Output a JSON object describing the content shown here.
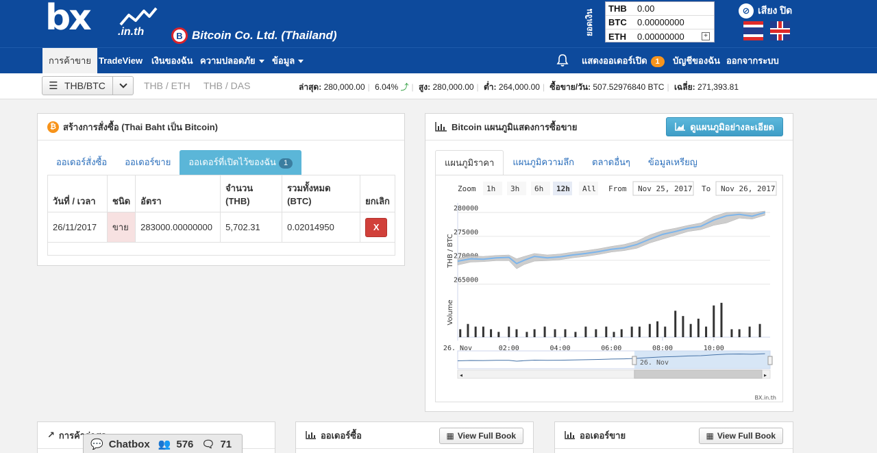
{
  "header": {
    "logo_main": "bx",
    "logo_sub": ".in.th",
    "company_name": "Bitcoin Co. Ltd. (Thailand)",
    "company_icon_letter": "B",
    "balance_label": "ยอดเงิน",
    "balances": [
      {
        "currency": "THB",
        "amount": "0.00"
      },
      {
        "currency": "BTC",
        "amount": "0.00000000"
      },
      {
        "currency": "ETH",
        "amount": "0.00000000"
      }
    ],
    "expand_symbol": "+",
    "sound_label": "เสียง ปิด"
  },
  "nav": {
    "items": [
      "การค้าขาย",
      "TradeView",
      "เงินของฉัน",
      "ความปลอดภัย",
      "ข้อมูล"
    ],
    "open_orders_label": "แสดงออเดอร์เปิด",
    "open_orders_count": "1",
    "account_label": "บัญชีของฉัน",
    "logout_label": "ออกจากระบบ"
  },
  "ticker": {
    "selected_pair": "THB/BTC",
    "pairs": [
      "THB / ETH",
      "THB / DAS"
    ],
    "last_label": "ล่าสุด:",
    "last_value": "280,000.00",
    "change": "6.04%",
    "high_label": "สูง:",
    "high_value": "280,000.00",
    "low_label": "ต่ำ:",
    "low_value": "264,000.00",
    "volume_label": "ซื้อขาย/วัน:",
    "volume_value": "507.52976840 BTC",
    "avg_label": "เฉลี่ย:",
    "avg_value": "271,393.81"
  },
  "order_panel": {
    "title": "สร้างการสั่งซื้อ (Thai Baht เป็น Bitcoin)",
    "tabs": [
      "ออเดอร์สั่งซื้อ",
      "ออเดอร์ขาย",
      "ออเดอร์ที่เปิดไว้ของฉัน"
    ],
    "tab_badge": "1",
    "columns": [
      "วันที่ / เวลา",
      "ชนิด",
      "อัตรา",
      "จำนวน (THB)",
      "รวมทั้งหมด (BTC)",
      "ยกเลิก"
    ],
    "rows": [
      {
        "date": "26/11/2017",
        "type": "ขาย",
        "rate": "283000.00000000",
        "amount": "5,702.31",
        "total": "0.02014950",
        "cancel": "X"
      }
    ]
  },
  "chart_panel": {
    "title": "Bitcoin แผนภูมิแสดงการซื้อขาย",
    "detail_button": "ดูแผนภูมิอย่างละเอียด",
    "tabs": [
      "แผนภูมิราคา",
      "แผนภูมิความลึก",
      "ตลาดอื่นๆ",
      "ข้อมูลเหรียญ"
    ],
    "zoom_label": "Zoom",
    "zoom_options": [
      "1h",
      "3h",
      "6h",
      "12h",
      "All"
    ],
    "zoom_selected": "12h",
    "from_label": "From",
    "from_value": "Nov 25, 2017",
    "to_label": "To",
    "to_value": "Nov 26, 2017",
    "credit": "BX.in.th"
  },
  "chart_data": {
    "type": "line",
    "title": "",
    "xlabel": "",
    "ylabel": "THB / BTC",
    "volume_label": "Volume",
    "ylim": [
      262500,
      282000
    ],
    "yticks": [
      265000,
      270000,
      275000,
      280000
    ],
    "xtick_labels": [
      "26. Nov",
      "02:00",
      "04:00",
      "06:00",
      "08:00",
      "10:00"
    ],
    "xtick_hours": [
      0,
      2,
      4,
      6,
      8,
      10
    ],
    "navigator_label": "26. Nov",
    "colors": {
      "line": "#7cb5ec",
      "band": "#c8c8c8",
      "volume": "#333333"
    },
    "x": [
      0,
      0.5,
      1,
      1.5,
      2,
      2.3,
      2.6,
      3,
      3.5,
      4,
      4.5,
      5,
      5.5,
      6,
      6.5,
      7,
      7.5,
      8,
      8.5,
      9,
      9.5,
      10,
      10.5,
      11,
      11.5,
      12
    ],
    "values": [
      269800,
      270300,
      270200,
      270500,
      270600,
      269300,
      270000,
      270800,
      270500,
      270700,
      271100,
      271400,
      271800,
      272300,
      272600,
      273300,
      274400,
      275400,
      276000,
      276700,
      277100,
      278400,
      279300,
      279600,
      279200,
      280000
    ],
    "range_low": [
      269000,
      269600,
      269700,
      269900,
      269900,
      268200,
      269100,
      269800,
      269900,
      270100,
      270500,
      270800,
      271200,
      271700,
      272000,
      272500,
      273600,
      274400,
      275200,
      276000,
      276400,
      277300,
      277800,
      278800,
      278600,
      279400
    ],
    "range_high": [
      270400,
      270900,
      270800,
      271000,
      271100,
      270300,
      270800,
      271400,
      271100,
      271300,
      271700,
      272000,
      272400,
      272900,
      273300,
      274000,
      275300,
      276200,
      276700,
      277300,
      277800,
      279200,
      280000,
      280100,
      279900,
      280300
    ],
    "volume_x": [
      0.1,
      0.4,
      0.7,
      1.0,
      1.3,
      1.6,
      2.0,
      2.3,
      2.7,
      3.0,
      3.4,
      3.8,
      4.2,
      4.6,
      5.0,
      5.4,
      5.8,
      6.1,
      6.4,
      6.8,
      7.1,
      7.5,
      7.8,
      8.1,
      8.5,
      8.8,
      9.1,
      9.4,
      9.7,
      10.0,
      10.3,
      10.7,
      11.0,
      11.4,
      11.8
    ],
    "volumes": [
      3,
      5,
      4,
      4,
      3,
      2,
      4,
      3,
      2,
      3,
      4,
      3,
      3,
      2,
      4,
      3,
      4,
      2,
      3,
      4,
      4,
      5,
      6,
      4,
      10,
      8,
      5,
      7,
      4,
      12,
      13,
      3,
      3,
      4,
      5
    ]
  },
  "bottom_panels": [
    {
      "title": "การค้าล่าสุด",
      "button": ""
    },
    {
      "title": "ออเดอร์ซื้อ",
      "button": "View Full Book"
    },
    {
      "title": "ออเดอร์ขาย",
      "button": "View Full Book"
    }
  ],
  "chatbox": {
    "label": "Chatbox",
    "users": "576",
    "messages": "71"
  }
}
